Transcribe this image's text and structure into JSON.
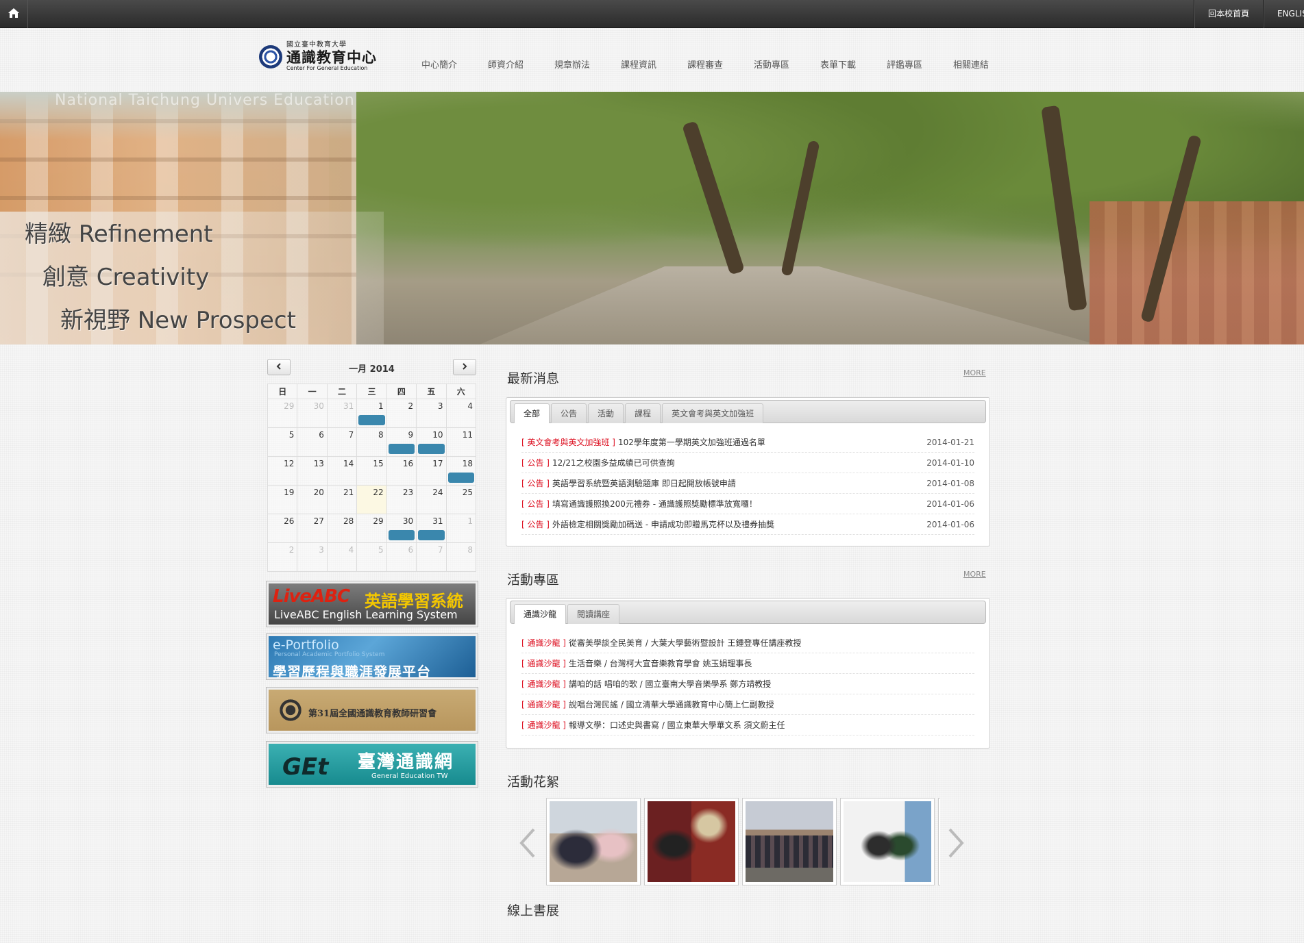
{
  "topbar": {
    "links": [
      {
        "label": "回本校首頁"
      },
      {
        "label": "ENGLISH"
      }
    ]
  },
  "logo": {
    "university": "國立臺中教育大學",
    "name": "通識教育中心",
    "english": "Center For General Education"
  },
  "nav": [
    "中心簡介",
    "師資介紹",
    "規章辦法",
    "課程資訊",
    "課程審查",
    "活動專區",
    "表單下載",
    "評鑑專區",
    "相關連結"
  ],
  "banner": {
    "ghost_text": "National Taichung Univers                Education",
    "taglines": [
      "精緻 Refinement",
      "創意 Creativity",
      "新視野 New Prospect"
    ]
  },
  "calendar": {
    "title": "一月 2014",
    "weekdays": [
      "日",
      "一",
      "二",
      "三",
      "四",
      "五",
      "六"
    ],
    "weeks": [
      [
        {
          "d": "29",
          "o": true
        },
        {
          "d": "30",
          "o": true
        },
        {
          "d": "31",
          "o": true
        },
        {
          "d": "1",
          "e": true
        },
        {
          "d": "2"
        },
        {
          "d": "3"
        },
        {
          "d": "4"
        }
      ],
      [
        {
          "d": "5"
        },
        {
          "d": "6"
        },
        {
          "d": "7"
        },
        {
          "d": "8"
        },
        {
          "d": "9",
          "e": true
        },
        {
          "d": "10",
          "e": true
        },
        {
          "d": "11"
        }
      ],
      [
        {
          "d": "12"
        },
        {
          "d": "13"
        },
        {
          "d": "14"
        },
        {
          "d": "15"
        },
        {
          "d": "16"
        },
        {
          "d": "17"
        },
        {
          "d": "18",
          "e": true
        }
      ],
      [
        {
          "d": "19"
        },
        {
          "d": "20"
        },
        {
          "d": "21"
        },
        {
          "d": "22",
          "t": true
        },
        {
          "d": "23"
        },
        {
          "d": "24"
        },
        {
          "d": "25"
        }
      ],
      [
        {
          "d": "26"
        },
        {
          "d": "27"
        },
        {
          "d": "28"
        },
        {
          "d": "29"
        },
        {
          "d": "30",
          "e": true
        },
        {
          "d": "31",
          "e": true
        },
        {
          "d": "1",
          "o": true
        }
      ],
      [
        {
          "d": "2",
          "o": true
        },
        {
          "d": "3",
          "o": true
        },
        {
          "d": "4",
          "o": true
        },
        {
          "d": "5",
          "o": true
        },
        {
          "d": "6",
          "o": true
        },
        {
          "d": "7",
          "o": true
        },
        {
          "d": "8",
          "o": true
        }
      ]
    ]
  },
  "side_banners": {
    "liveabc": {
      "brand": "LiveABC",
      "title": "英語學習系統",
      "subtitle": "LiveABC English Learning System"
    },
    "eportfolio": {
      "title": "e-Portfolio",
      "subtitle": "Personal Academic Portfolio System",
      "label": "學習歷程與職涯發展平台"
    },
    "conference": {
      "label": "第31屆全國通識教育教師研習會"
    },
    "get": {
      "brand": "GEt",
      "title": "臺灣通識網",
      "subtitle": "General Education TW"
    }
  },
  "news": {
    "title": "最新消息",
    "more": "MORE",
    "tabs": [
      "全部",
      "公告",
      "活動",
      "課程",
      "英文會考與英文加強班"
    ],
    "items": [
      {
        "cat": "[ 英文會考與英文加強班 ]",
        "title": "102學年度第一學期英文加強班通過名單",
        "date": "2014-01-21"
      },
      {
        "cat": "[ 公告 ]",
        "title": "12/21之校園多益成績已可供查詢",
        "date": "2014-01-10"
      },
      {
        "cat": "[ 公告 ]",
        "title": "英語學習系統暨英語測驗題庫 即日起開放帳號申請",
        "date": "2014-01-08"
      },
      {
        "cat": "[ 公告 ]",
        "title": "填寫通識護照換200元禮券 - 通識護照獎勵標準放寬囉！",
        "date": "2014-01-06"
      },
      {
        "cat": "[ 公告 ]",
        "title": "外語檢定相關獎勵加碼送 - 申請成功即贈馬克杯以及禮券抽獎",
        "date": "2014-01-06"
      }
    ]
  },
  "activities": {
    "title": "活動專區",
    "more": "MORE",
    "tabs": [
      "通識沙龍",
      "閱讀講座"
    ],
    "items": [
      {
        "cat": "[ 通識沙龍 ]",
        "title": "從審美學談全民美育 / 大葉大學藝術暨設計 王鍾登專任講座教授"
      },
      {
        "cat": "[ 通識沙龍 ]",
        "title": "生活音樂 / 台灣柯大宜音樂教育學會 姚玉娟理事長"
      },
      {
        "cat": "[ 通識沙龍 ]",
        "title": "講咱的話 唱咱的歌 / 國立臺南大學音樂學系 鄭方靖教授"
      },
      {
        "cat": "[ 通識沙龍 ]",
        "title": "說唱台灣民謠 / 國立清華大學通識教育中心簡上仁副教授"
      },
      {
        "cat": "[ 通識沙龍 ]",
        "title": "報導文學：口述史與書寫 / 國立東華大學華文系 須文蔚主任"
      }
    ]
  },
  "gallery": {
    "title": "活動花絮"
  },
  "books": {
    "title": "線上書展"
  }
}
